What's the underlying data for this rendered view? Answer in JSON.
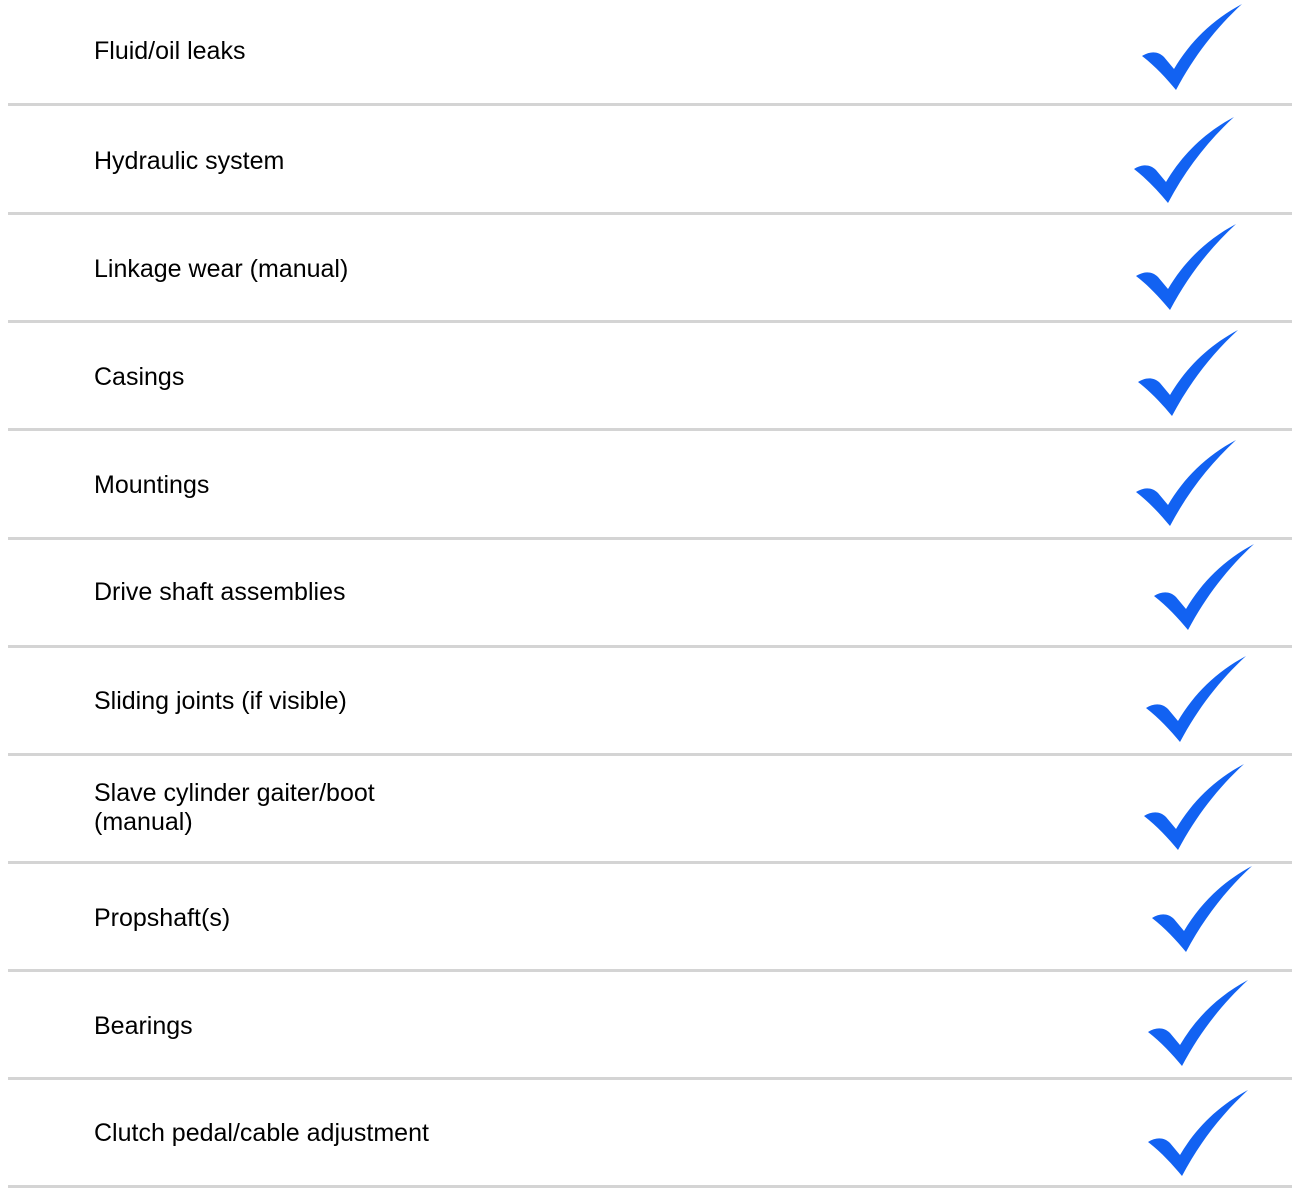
{
  "checklist": {
    "accent_color": "#1262f2",
    "divider_color": "#d4d4d4",
    "icon": "checkmark-icon",
    "items": [
      {
        "label": "Fluid/oil leaks",
        "checked": true
      },
      {
        "label": "Hydraulic system",
        "checked": true
      },
      {
        "label": "Linkage wear (manual)",
        "checked": true
      },
      {
        "label": "Casings",
        "checked": true
      },
      {
        "label": "Mountings",
        "checked": true
      },
      {
        "label": "Drive shaft assemblies",
        "checked": true
      },
      {
        "label": "Sliding joints (if visible)",
        "checked": true
      },
      {
        "label": "Slave cylinder gaiter/boot\n(manual)",
        "checked": true
      },
      {
        "label": "Propshaft(s)",
        "checked": true
      },
      {
        "label": "Bearings",
        "checked": true
      },
      {
        "label": "Clutch pedal/cable adjustment",
        "checked": true
      }
    ]
  }
}
